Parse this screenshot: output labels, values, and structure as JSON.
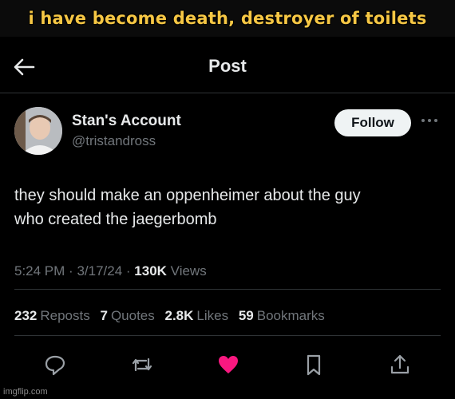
{
  "meme": {
    "caption": "i have become death, destroyer of toilets"
  },
  "header": {
    "title": "Post"
  },
  "author": {
    "display_name": "Stan's Account",
    "handle": "@tristandross",
    "follow_label": "Follow"
  },
  "tweet": {
    "line1": "they should make an oppenheimer about the guy",
    "line2": "who created the jaegerbomb"
  },
  "meta": {
    "time": "5:24 PM",
    "date": "3/17/24",
    "views_count": "130K",
    "views_label": "Views"
  },
  "stats": {
    "reposts": {
      "count": "232",
      "label": "Reposts"
    },
    "quotes": {
      "count": "7",
      "label": "Quotes"
    },
    "likes": {
      "count": "2.8K",
      "label": "Likes"
    },
    "bookmarks": {
      "count": "59",
      "label": "Bookmarks"
    }
  },
  "colors": {
    "caption": "#f6c744",
    "like_active": "#f91880",
    "muted": "#71767b",
    "text": "#e7e9ea"
  },
  "icons": [
    "back-arrow-icon",
    "more-icon",
    "reply-icon",
    "repost-icon",
    "like-icon",
    "bookmark-icon",
    "share-icon"
  ],
  "watermark": "imgflip.com"
}
